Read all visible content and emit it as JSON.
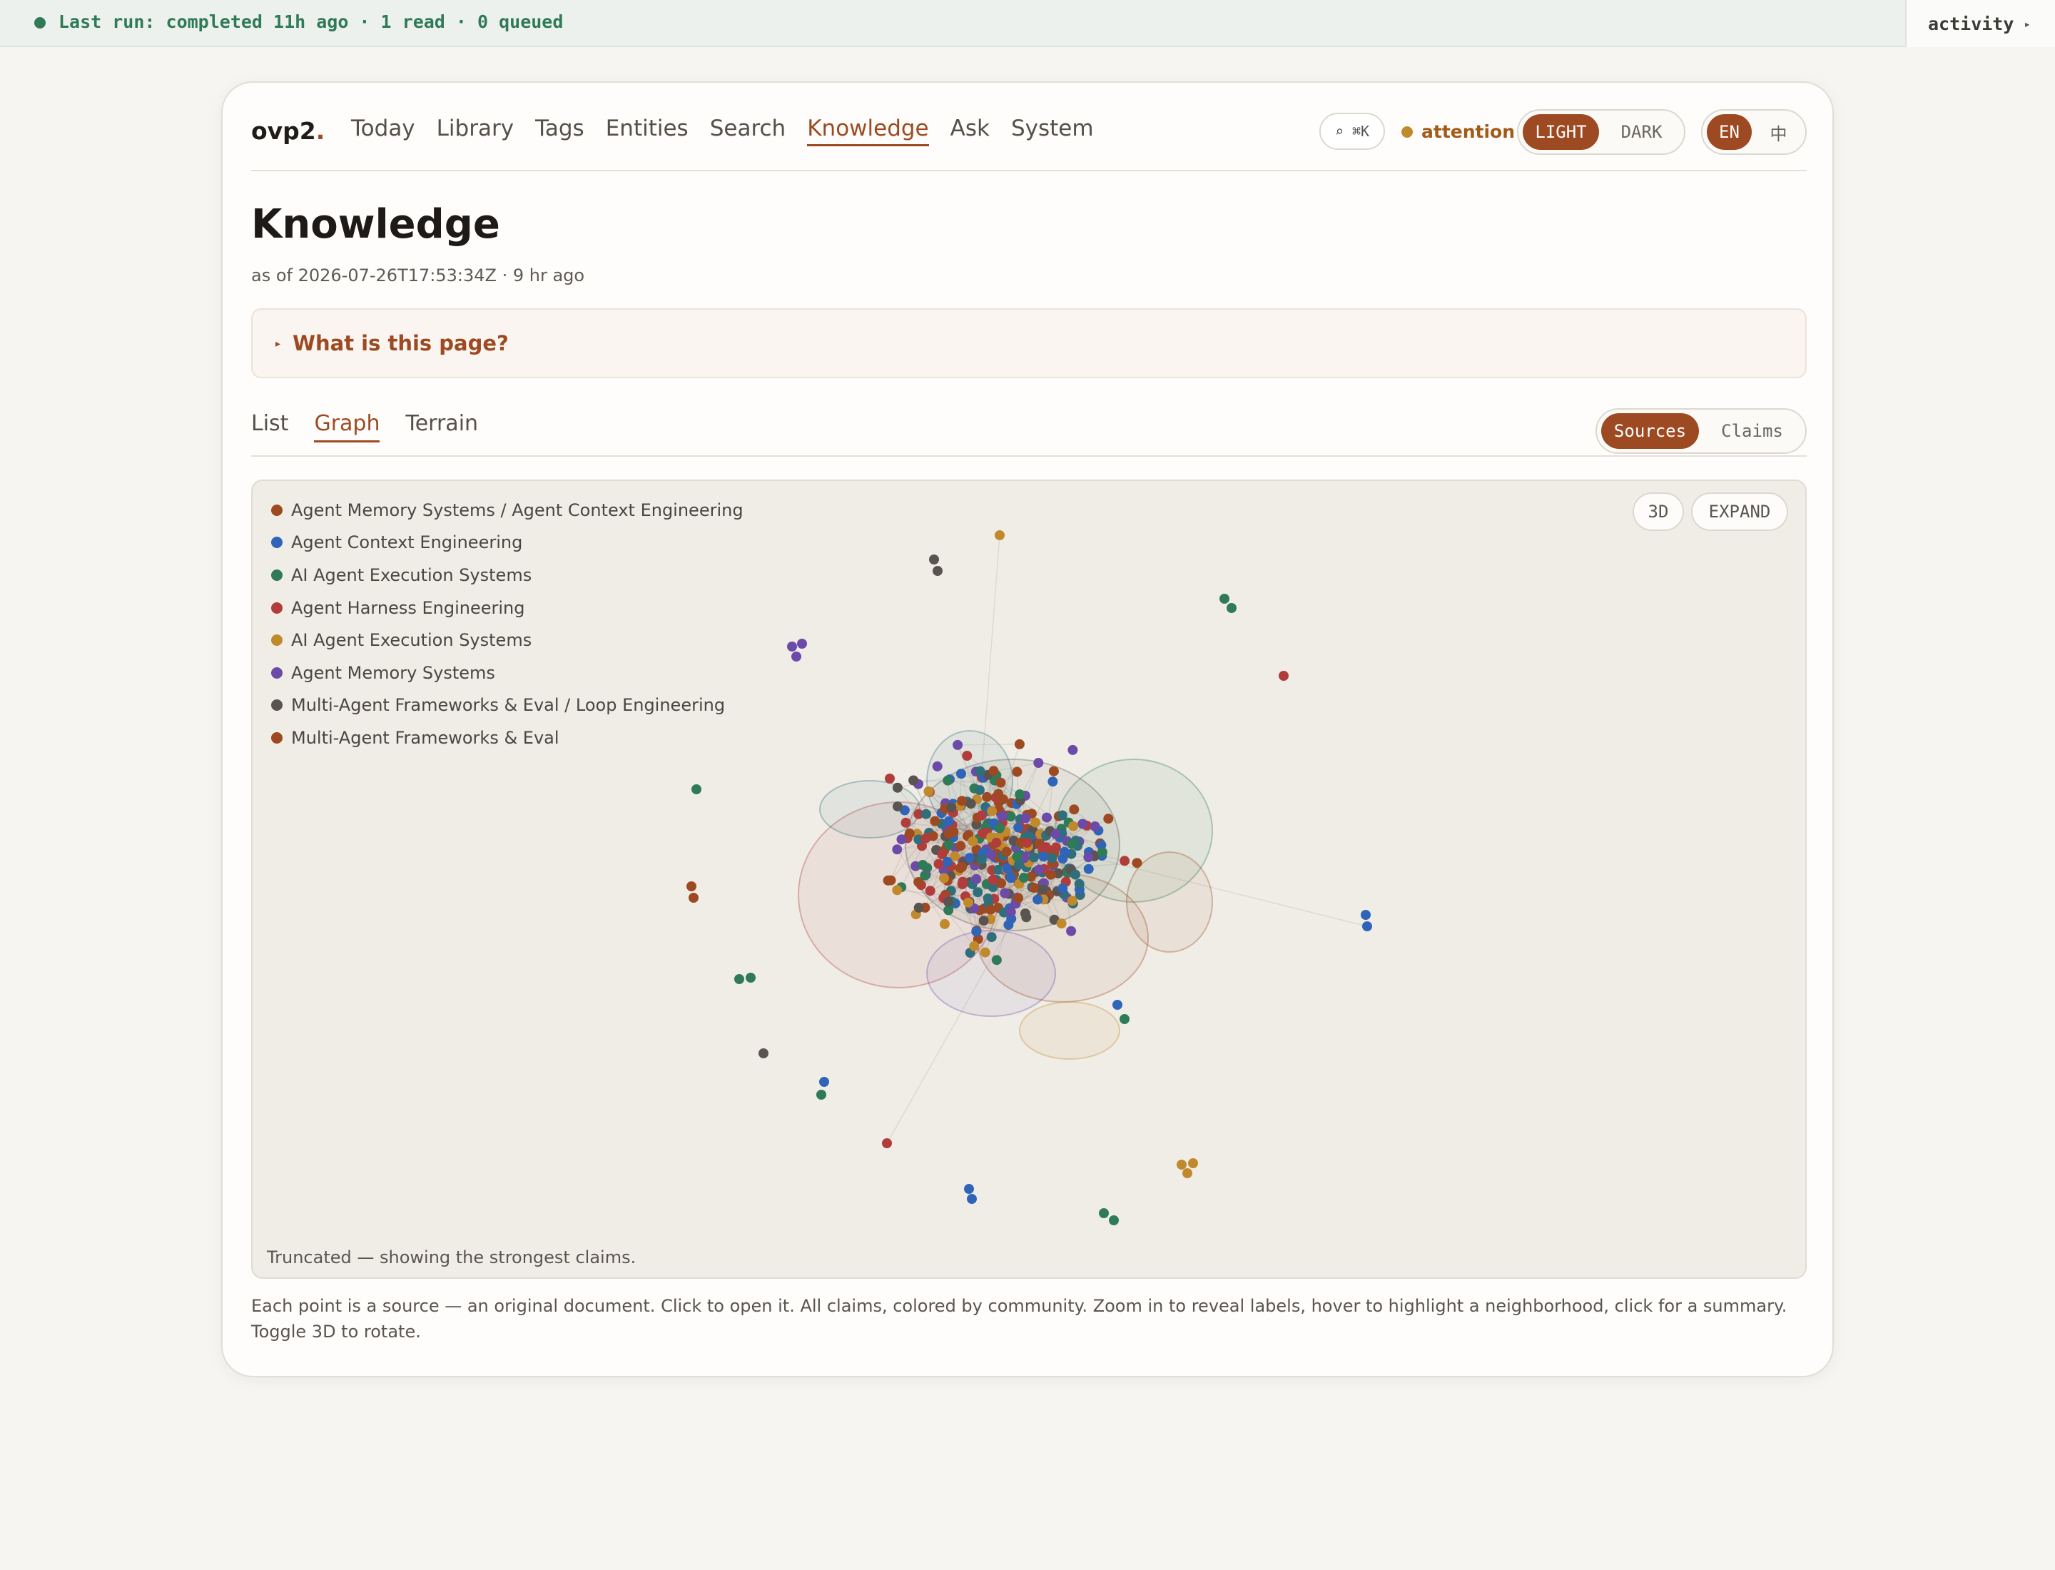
{
  "status_bar": {
    "text": "Last run: completed 11h ago · 1 read · 0 queued",
    "activity_label": "activity",
    "status_color": "#2f7a57"
  },
  "header": {
    "brand": "ovp2",
    "brand_dot": ".",
    "nav": [
      {
        "label": "Today",
        "active": false
      },
      {
        "label": "Library",
        "active": false
      },
      {
        "label": "Tags",
        "active": false
      },
      {
        "label": "Entities",
        "active": false
      },
      {
        "label": "Search",
        "active": false
      },
      {
        "label": "Knowledge",
        "active": true
      },
      {
        "label": "Ask",
        "active": false
      },
      {
        "label": "System",
        "active": false
      }
    ],
    "search_shortcut": "⌕ ⌘K",
    "attention_label": "attention",
    "theme": {
      "light": "LIGHT",
      "dark": "DARK",
      "selected": "LIGHT"
    },
    "lang": {
      "en": "EN",
      "zh": "中",
      "selected": "EN"
    }
  },
  "page": {
    "title": "Knowledge",
    "as_of": "as of 2026-07-26T17:53:34Z · 9 hr ago",
    "help_label": "What is this page?",
    "tabs": [
      {
        "label": "List",
        "active": false
      },
      {
        "label": "Graph",
        "active": true
      },
      {
        "label": "Terrain",
        "active": false
      }
    ],
    "view_toggle": {
      "sources": "Sources",
      "claims": "Claims",
      "selected": "Sources"
    }
  },
  "graph": {
    "btn_3d": "3D",
    "btn_expand": "EXPAND",
    "truncated_note": "Truncated — showing the strongest claims.",
    "legend": [
      {
        "label": "Agent Memory Systems / Agent Context Engineering",
        "color": "#9d4a22"
      },
      {
        "label": "Agent Context Engineering",
        "color": "#2f64b8"
      },
      {
        "label": "AI Agent Execution Systems",
        "color": "#2f7a57"
      },
      {
        "label": "Agent Harness Engineering",
        "color": "#b03c3c"
      },
      {
        "label": "AI Agent Execution Systems",
        "color": "#c08a2c"
      },
      {
        "label": "Agent Memory Systems",
        "color": "#6c4aa8"
      },
      {
        "label": "Multi-Agent Frameworks & Eval / Loop Engineering",
        "color": "#5a5450"
      },
      {
        "label": "Multi-Agent Frameworks & Eval",
        "color": "#9d4a22"
      }
    ],
    "extra_color": "#2f6e7a"
  },
  "footnote": "Each point is a source — an original document. Click to open it. All claims, colored by community. Zoom in to reveal labels, hover to highlight a neighborhood, click for a summary. Toggle 3D to rotate."
}
